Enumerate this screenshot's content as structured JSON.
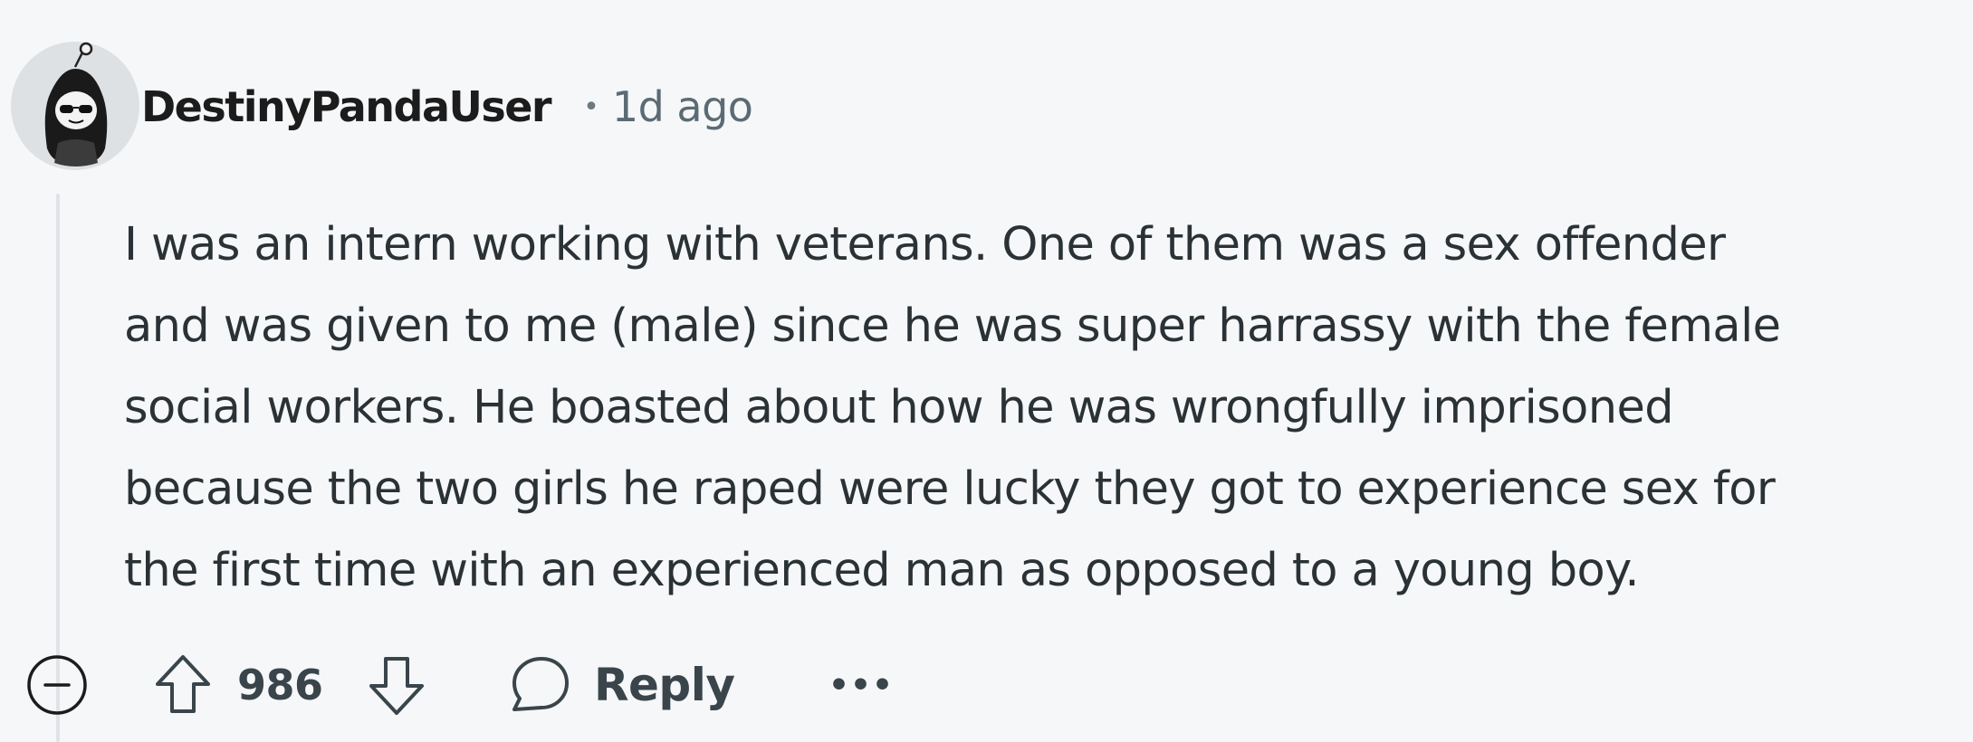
{
  "comment": {
    "username": "DestinyPandaUser",
    "separator": "•",
    "timestamp": "1d ago",
    "body_lines": [
      "I was an intern working with veterans. One of them was a sex offender",
      "and was given to me (male) since he was super harrassy with the female",
      "social workers. He boasted about how he was wrongfully imprisoned",
      "because the two girls he raped were lucky they got to experience sex for",
      "the first time with an experienced man as opposed to a young boy."
    ]
  },
  "actions": {
    "score": "986",
    "reply_label": "Reply",
    "more_label": "•••"
  },
  "icons": {
    "collapse": "collapse-minus-icon",
    "upvote": "upvote-arrow-icon",
    "downvote": "downvote-arrow-icon",
    "reply": "speech-bubble-icon",
    "more": "overflow-menu-icon"
  },
  "colors": {
    "background": "#f6f7f9",
    "text": "#2a3236",
    "muted": "#5c6b73",
    "thread_line": "#dfe3e7"
  }
}
